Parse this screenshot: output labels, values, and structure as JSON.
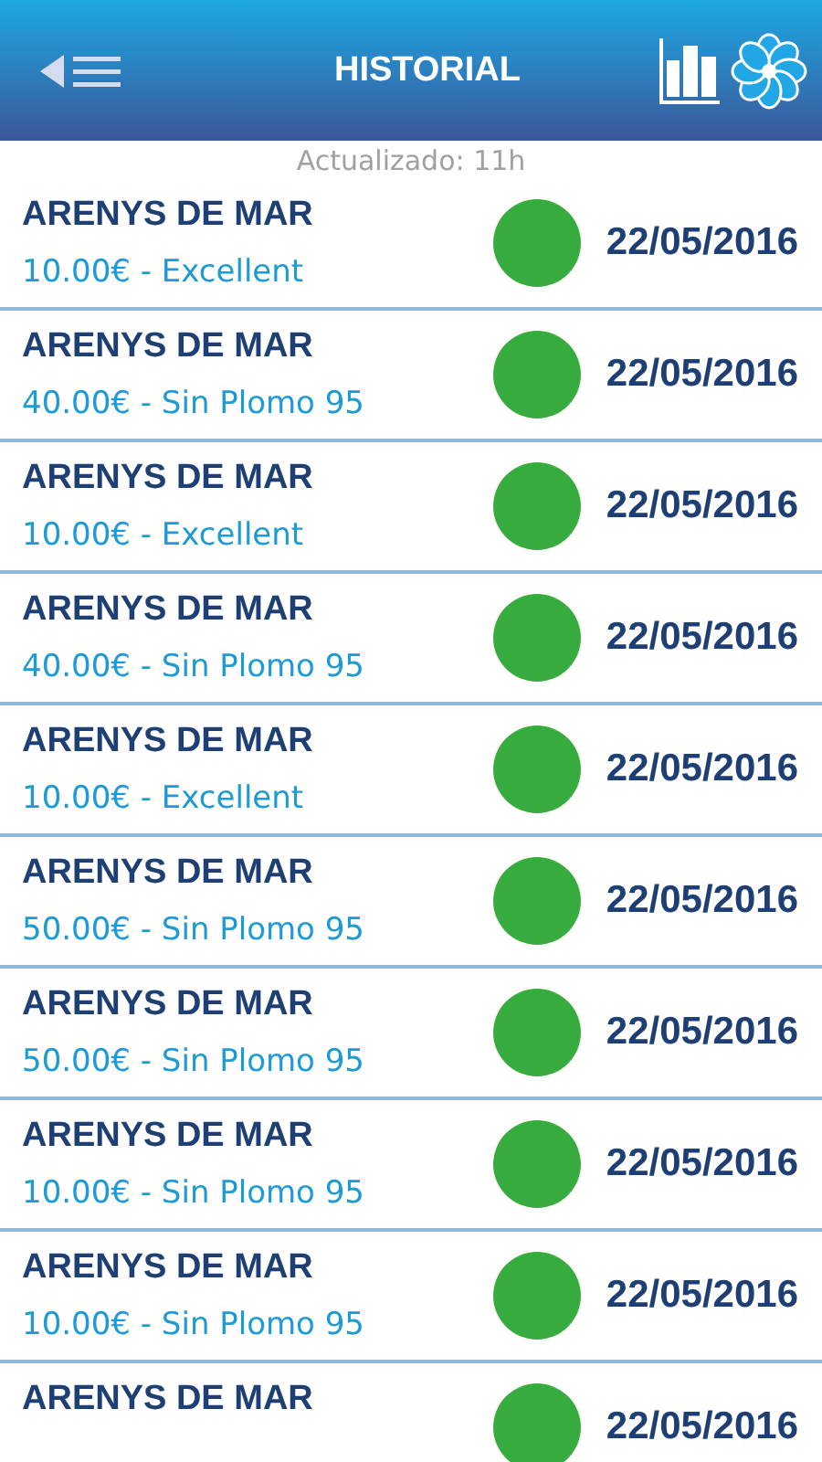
{
  "header": {
    "title": "HISTORIAL"
  },
  "updated": "Actualizado: 11h",
  "rows": [
    {
      "station": "ARENYS DE MAR",
      "detail": "10.00€ - Excellent",
      "color": "#38ab3e",
      "date": "22/05/2016"
    },
    {
      "station": "ARENYS DE MAR",
      "detail": "40.00€ - Sin Plomo 95",
      "color": "#38ab3e",
      "date": "22/05/2016"
    },
    {
      "station": "ARENYS DE MAR",
      "detail": "10.00€ - Excellent",
      "color": "#38ab3e",
      "date": "22/05/2016"
    },
    {
      "station": "ARENYS DE MAR",
      "detail": "40.00€ - Sin Plomo 95",
      "color": "#38ab3e",
      "date": "22/05/2016"
    },
    {
      "station": "ARENYS DE MAR",
      "detail": "10.00€ - Excellent",
      "color": "#38ab3e",
      "date": "22/05/2016"
    },
    {
      "station": "ARENYS DE MAR",
      "detail": "50.00€ - Sin Plomo 95",
      "color": "#38ab3e",
      "date": "22/05/2016"
    },
    {
      "station": "ARENYS DE MAR",
      "detail": "50.00€ - Sin Plomo 95",
      "color": "#38ab3e",
      "date": "22/05/2016"
    },
    {
      "station": "ARENYS DE MAR",
      "detail": "10.00€ - Sin Plomo 95",
      "color": "#38ab3e",
      "date": "22/05/2016"
    },
    {
      "station": "ARENYS DE MAR",
      "detail": "10.00€ - Sin Plomo 95",
      "color": "#38ab3e",
      "date": "22/05/2016"
    },
    {
      "station": "ARENYS DE MAR",
      "color": "#38ab3e",
      "date": "22/05/2016"
    }
  ]
}
